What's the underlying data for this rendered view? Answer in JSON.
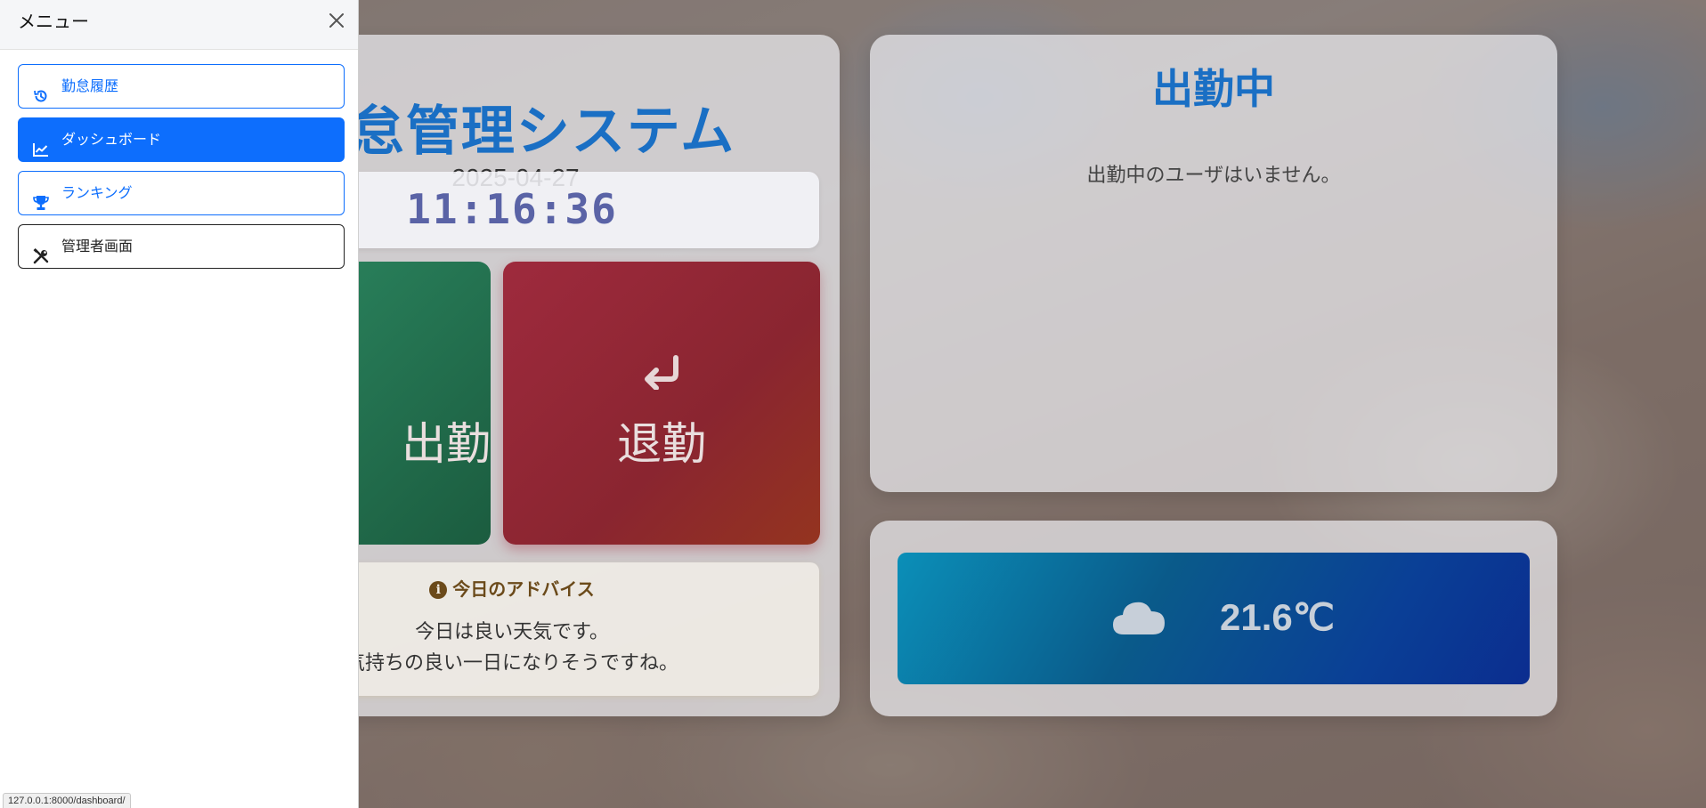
{
  "main": {
    "system_title": "勤怠管理システム",
    "date": "2025-04-27",
    "clock": "11:16:36",
    "clock_in_label": "出勤",
    "clock_out_label": "退勤",
    "clock_out_icon": "return-arrow-icon",
    "advice": {
      "title": "今日のアドバイス",
      "line1": "今日は良い天気です。",
      "line2": "気持ちの良い一日になりそうですね。"
    }
  },
  "status": {
    "title": "出勤中",
    "empty_message": "出勤中のユーザはいません。"
  },
  "weather": {
    "icon": "cloud-icon",
    "temperature": "21.6℃"
  },
  "sidebar": {
    "title": "メニュー",
    "items": [
      {
        "label": "勤怠履歴",
        "icon": "history-icon"
      },
      {
        "label": "ダッシュボード",
        "icon": "chart-icon"
      },
      {
        "label": "ランキング",
        "icon": "trophy-icon"
      },
      {
        "label": "管理者画面",
        "icon": "tools-icon"
      }
    ]
  },
  "status_bar": {
    "url": "127.0.0.1:8000/dashboard/"
  },
  "colors": {
    "primary": "#0d6efd",
    "title_blue": "#1a6fc4",
    "clock_in_green": "#1b5c3f",
    "clock_out_red": "#9e2a3d"
  }
}
